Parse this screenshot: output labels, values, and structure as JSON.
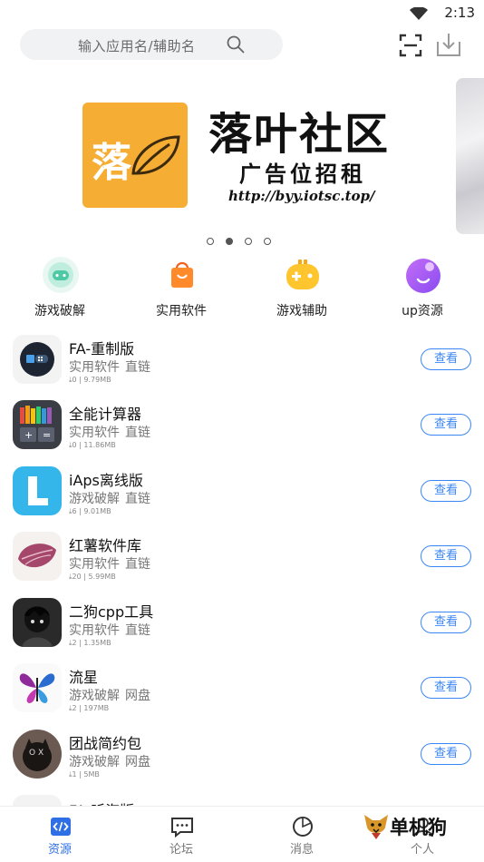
{
  "status_bar": {
    "time": "2:13",
    "wifi_icon": "wifi-icon"
  },
  "search": {
    "placeholder": "输入应用名/辅助名",
    "icon": "search-icon"
  },
  "header_actions": {
    "scan_icon": "scan-icon",
    "download_icon": "download-icon"
  },
  "banner": {
    "logo_char": "落",
    "title": "落叶社区",
    "subtitle": "广告位招租",
    "url": "http://byy.iotsc.top/",
    "active_index": 1,
    "dot_count": 4
  },
  "categories": [
    {
      "label": "游戏破解",
      "icon": "gamepad-icon"
    },
    {
      "label": "实用软件",
      "icon": "shopping-bag-icon"
    },
    {
      "label": "游戏辅助",
      "icon": "game-controller-icon"
    },
    {
      "label": "up资源",
      "icon": "smile-icon"
    }
  ],
  "apps": [
    {
      "name": "FA-重制版",
      "category": "实用软件",
      "link_type": "直链",
      "downloads": "0",
      "size": "9.79MB",
      "button": "查看"
    },
    {
      "name": "全能计算器",
      "category": "实用软件",
      "link_type": "直链",
      "downloads": "0",
      "size": "11.86MB",
      "button": "查看"
    },
    {
      "name": "iAps离线版",
      "category": "游戏破解",
      "link_type": "直链",
      "downloads": "6",
      "size": "9.01MB",
      "button": "查看"
    },
    {
      "name": "红薯软件库",
      "category": "实用软件",
      "link_type": "直链",
      "downloads": "20",
      "size": "5.99MB",
      "button": "查看"
    },
    {
      "name": "二狗cpp工具",
      "category": "实用软件",
      "link_type": "直链",
      "downloads": "2",
      "size": "1.35MB",
      "button": "查看"
    },
    {
      "name": "流星",
      "category": "游戏破解",
      "link_type": "网盘",
      "downloads": "2",
      "size": "197MB",
      "button": "查看"
    },
    {
      "name": "团战简约包",
      "category": "游戏破解",
      "link_type": "网盘",
      "downloads": "1",
      "size": "5MB",
      "button": "查看"
    },
    {
      "name": "FA-听海版"
    }
  ],
  "tabs": [
    {
      "label": "资源",
      "icon": "code-icon",
      "active": true
    },
    {
      "label": "论坛",
      "icon": "chat-icon",
      "active": false
    },
    {
      "label": "消息",
      "icon": "message-icon",
      "active": false
    },
    {
      "label": "个人",
      "icon": "person-icon",
      "active": false
    }
  ],
  "watermark": {
    "text": "单机狗"
  },
  "colors": {
    "accent": "#3b86f6",
    "active_tab": "#2f6fe6",
    "banner_logo": "#f6ad33"
  }
}
